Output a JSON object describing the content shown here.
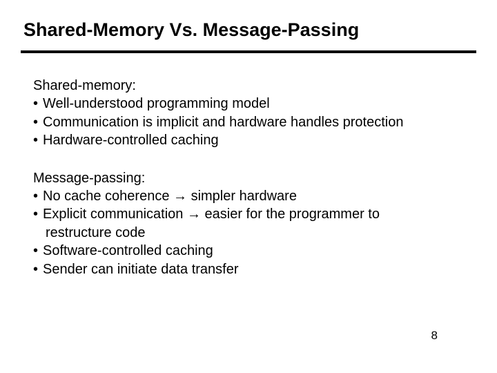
{
  "title": "Shared-Memory Vs. Message-Passing",
  "sec1": {
    "head": "Shared-memory:",
    "b1": "Well-understood programming model",
    "b2": "Communication is implicit and hardware handles protection",
    "b3": "Hardware-controlled caching"
  },
  "sec2": {
    "head": "Message-passing:",
    "b1a": "No cache coherence ",
    "b1b": " simpler hardware",
    "b2a": "Explicit communication ",
    "b2b": " easier for the programmer to",
    "b2c": "restructure code",
    "b3": "Software-controlled caching",
    "b4": "Sender can initiate data transfer"
  },
  "arrow": "→",
  "bullet": "•",
  "page": "8"
}
